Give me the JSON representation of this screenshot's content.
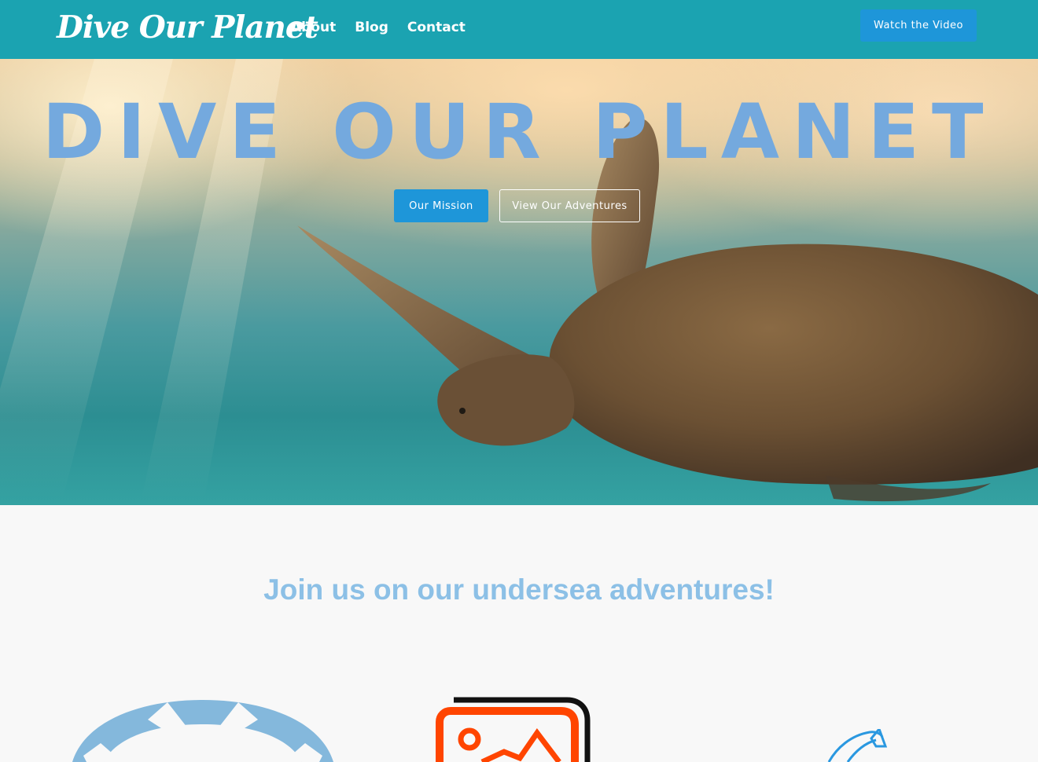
{
  "navbar": {
    "brand": "Dive Our Planet",
    "links": [
      "About",
      "Blog",
      "Contact"
    ],
    "cta_label": "Watch the Video"
  },
  "hero": {
    "title": "DIVE OUR PLANET",
    "primary_button": "Our Mission",
    "secondary_button": "View Our Adventures"
  },
  "section": {
    "heading": "Join us on our undersea adventures!",
    "icons": [
      "life-ring-icon",
      "image-icon",
      "fish-icon"
    ]
  },
  "colors": {
    "navbar_bg": "#1ba3b1",
    "accent_blue": "#1e96d9",
    "hero_title": "#74a9de",
    "heading": "#8cc0e6",
    "image_icon_orange": "#ff4500"
  }
}
